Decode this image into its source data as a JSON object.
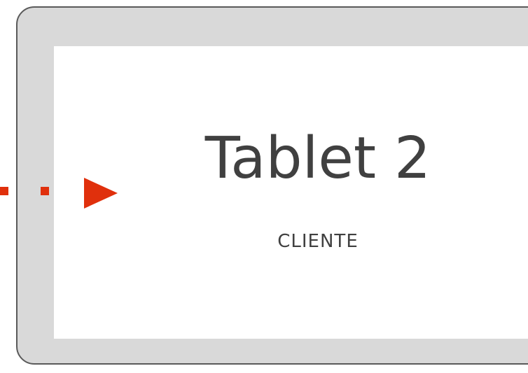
{
  "tablet": {
    "title": "Tablet 2",
    "subtitle": "CLIENTE"
  },
  "colors": {
    "frame_fill": "#d9d9d9",
    "frame_border": "#5a5a5a",
    "screen": "#ffffff",
    "text": "#404040",
    "arrow": "#e0300c"
  }
}
